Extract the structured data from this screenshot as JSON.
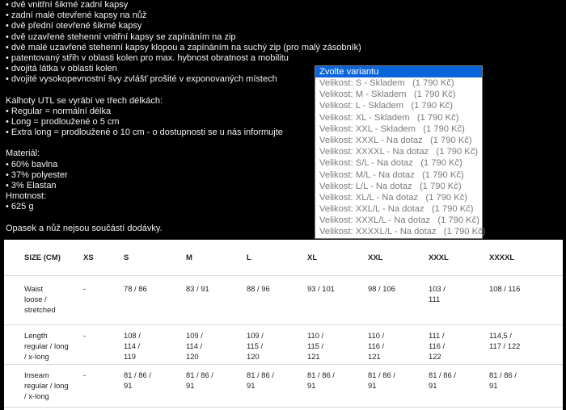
{
  "description": {
    "features": [
      "• dvě vnitřní šikmé zadní kapsy",
      "• zadní malé otevřené kapsy na nůž",
      "• dvě přední otevřené šikmé kapsy",
      "• dvě uzavřené stehenní vnitřní kapsy se zapínáním na zip",
      "• dvě malé uzavřené stehenní kapsy klopou a zapínáním na suchý zip (pro malý zásobník)",
      "• patentovaný střih v oblasti kolen pro max. hybnost obratnost a mobilitu",
      "• dvojitá látka v oblasti kolen",
      "• dvojité vysokopevnostní švy zvlášť prošité v exponovaných místech"
    ],
    "lengths_heading": "Kalhoty UTL se vyrábí ve třech délkách:",
    "lengths": [
      "• Regular = normální délka",
      "• Long = prodloužené o 5 cm",
      "• Extra long = prodloužené o 10 cm - o dostupnosti se u nás informujte"
    ],
    "material_heading": "Materiál:",
    "materials": [
      "• 60% bavlna",
      "• 37% polyester",
      "• 3% Elastan"
    ],
    "weight_heading": "Hmotnost:",
    "weight": "• 625 g",
    "note": "Opasek a nůž nejsou součástí dodávky."
  },
  "variant_select": {
    "header": "Zvolte variantu",
    "options": [
      "Velikost: S - Skladem    (1 790 Kč)",
      "Velikost: M - Skladem    (1 790 Kč)",
      "Velikost: L - Skladem    (1 790 Kč)",
      "Velikost: XL - Skladem    (1 790 Kč)",
      "Velikost: XXL - Skladem    (1 790 Kč)",
      "Velikost: XXXL - Na dotaz    (1 790 Kč)",
      "Velikost: XXXXL - Na dotaz    (1 790 Kč)",
      "Velikost: S/L - Na dotaz    (1 790 Kč)",
      "Velikost: M/L - Na dotaz    (1 790 Kč)",
      "Velikost: L/L - Na dotaz    (1 790 Kč)",
      "Velikost: XL/L - Na dotaz    (1 790 Kč)",
      "Velikost: XXL/L - Na dotaz    (1 790 Kč)",
      "Velikost: XXXL/L - Na dotaz    (1 790 Kč)",
      "Velikost: XXXXL/L - Na dotaz    (1 790 Kč)"
    ]
  },
  "size_table": {
    "headers": [
      "SIZE (CM)",
      "XS",
      "S",
      "M",
      "L",
      "XL",
      "XXL",
      "XXXL",
      "XXXXL"
    ],
    "rows": [
      {
        "label": [
          "Waist",
          "loose /",
          "stretched"
        ],
        "cells": [
          [
            "-"
          ],
          [
            "78 / 86"
          ],
          [
            "83 / 91"
          ],
          [
            "88 / 96"
          ],
          [
            "93 / 101"
          ],
          [
            "98 / 106"
          ],
          [
            "103 /",
            "111"
          ],
          [
            "108 / 116"
          ]
        ]
      },
      {
        "label": [
          "Length",
          "regular / long",
          "/ x-long"
        ],
        "cells": [
          [
            "-"
          ],
          [
            "108 /",
            "114 /",
            "119"
          ],
          [
            "109 /",
            "114 /",
            "120"
          ],
          [
            "109 /",
            "115 /",
            "120"
          ],
          [
            "110 /",
            "115 /",
            "121"
          ],
          [
            "110 /",
            "116 /",
            "121"
          ],
          [
            "111 /",
            "116 /",
            "122"
          ],
          [
            "114,5 /",
            "117 / 122"
          ]
        ]
      },
      {
        "label": [
          "Inseam",
          "regular / long",
          "/ x-long"
        ],
        "cells": [
          [
            "-"
          ],
          [
            "81 / 86 /",
            "91"
          ],
          [
            "81 / 86 /",
            "91"
          ],
          [
            "81 / 86 /",
            "91"
          ],
          [
            "81 / 86 /",
            "91"
          ],
          [
            "81 / 86 /",
            "91"
          ],
          [
            "81 / 86 /",
            "91"
          ],
          [
            "81 / 86 /",
            "91"
          ]
        ]
      }
    ]
  }
}
